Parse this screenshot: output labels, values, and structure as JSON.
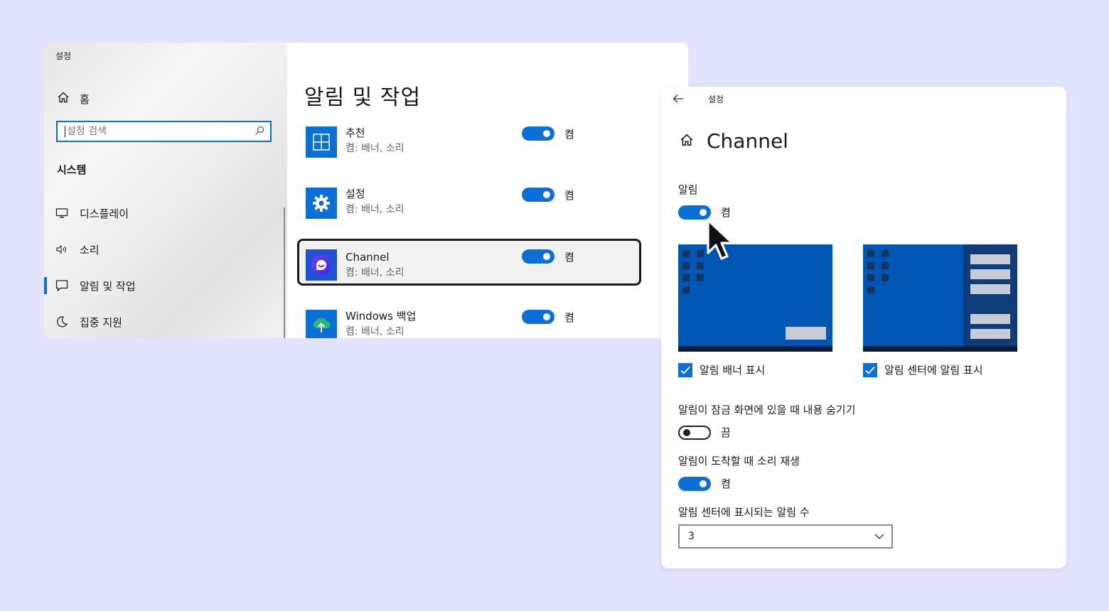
{
  "back_window": {
    "app_title": "설정",
    "sidebar": {
      "home_label": "홈",
      "search_placeholder": "설정 검색",
      "section_header": "시스템",
      "items": [
        {
          "label": "디스플레이",
          "icon": "monitor-icon"
        },
        {
          "label": "소리",
          "icon": "speaker-icon"
        },
        {
          "label": "알림 및 작업",
          "icon": "notification-icon",
          "active": true
        },
        {
          "label": "집중 지원",
          "icon": "moon-icon"
        }
      ]
    },
    "content": {
      "title": "알림 및 작업",
      "apps": [
        {
          "name": "추천",
          "sub": "켬: 배너, 소리",
          "state": "켬",
          "icon": "tips-icon"
        },
        {
          "name": "설정",
          "sub": "켬: 배너, 소리",
          "state": "켬",
          "icon": "gear-icon"
        },
        {
          "name": "Channel",
          "sub": "켬: 배너, 소리",
          "state": "켬",
          "icon": "channel-icon",
          "selected": true
        },
        {
          "name": "Windows 백업",
          "sub": "켬: 배너, 소리",
          "state": "켬",
          "icon": "backup-icon"
        }
      ]
    }
  },
  "front_window": {
    "app_title": "설정",
    "title": "Channel",
    "notifications": {
      "label": "알림",
      "state": "켬"
    },
    "banner_check": "알림 배너 표시",
    "center_check": "알림 센터에 알림 표시",
    "lock_screen": {
      "label": "알림이 잠금 화면에 있을 때 내용 숨기기",
      "state": "끔"
    },
    "sound": {
      "label": "알림이 도착할 때 소리 재생",
      "state": "켬"
    },
    "count": {
      "label": "알림 센터에 표시되는 알림 수",
      "value": "3"
    }
  },
  "colors": {
    "accent": "#0a6fd6",
    "background": "#e2e3fd",
    "preview_blue": "#0056b3"
  }
}
